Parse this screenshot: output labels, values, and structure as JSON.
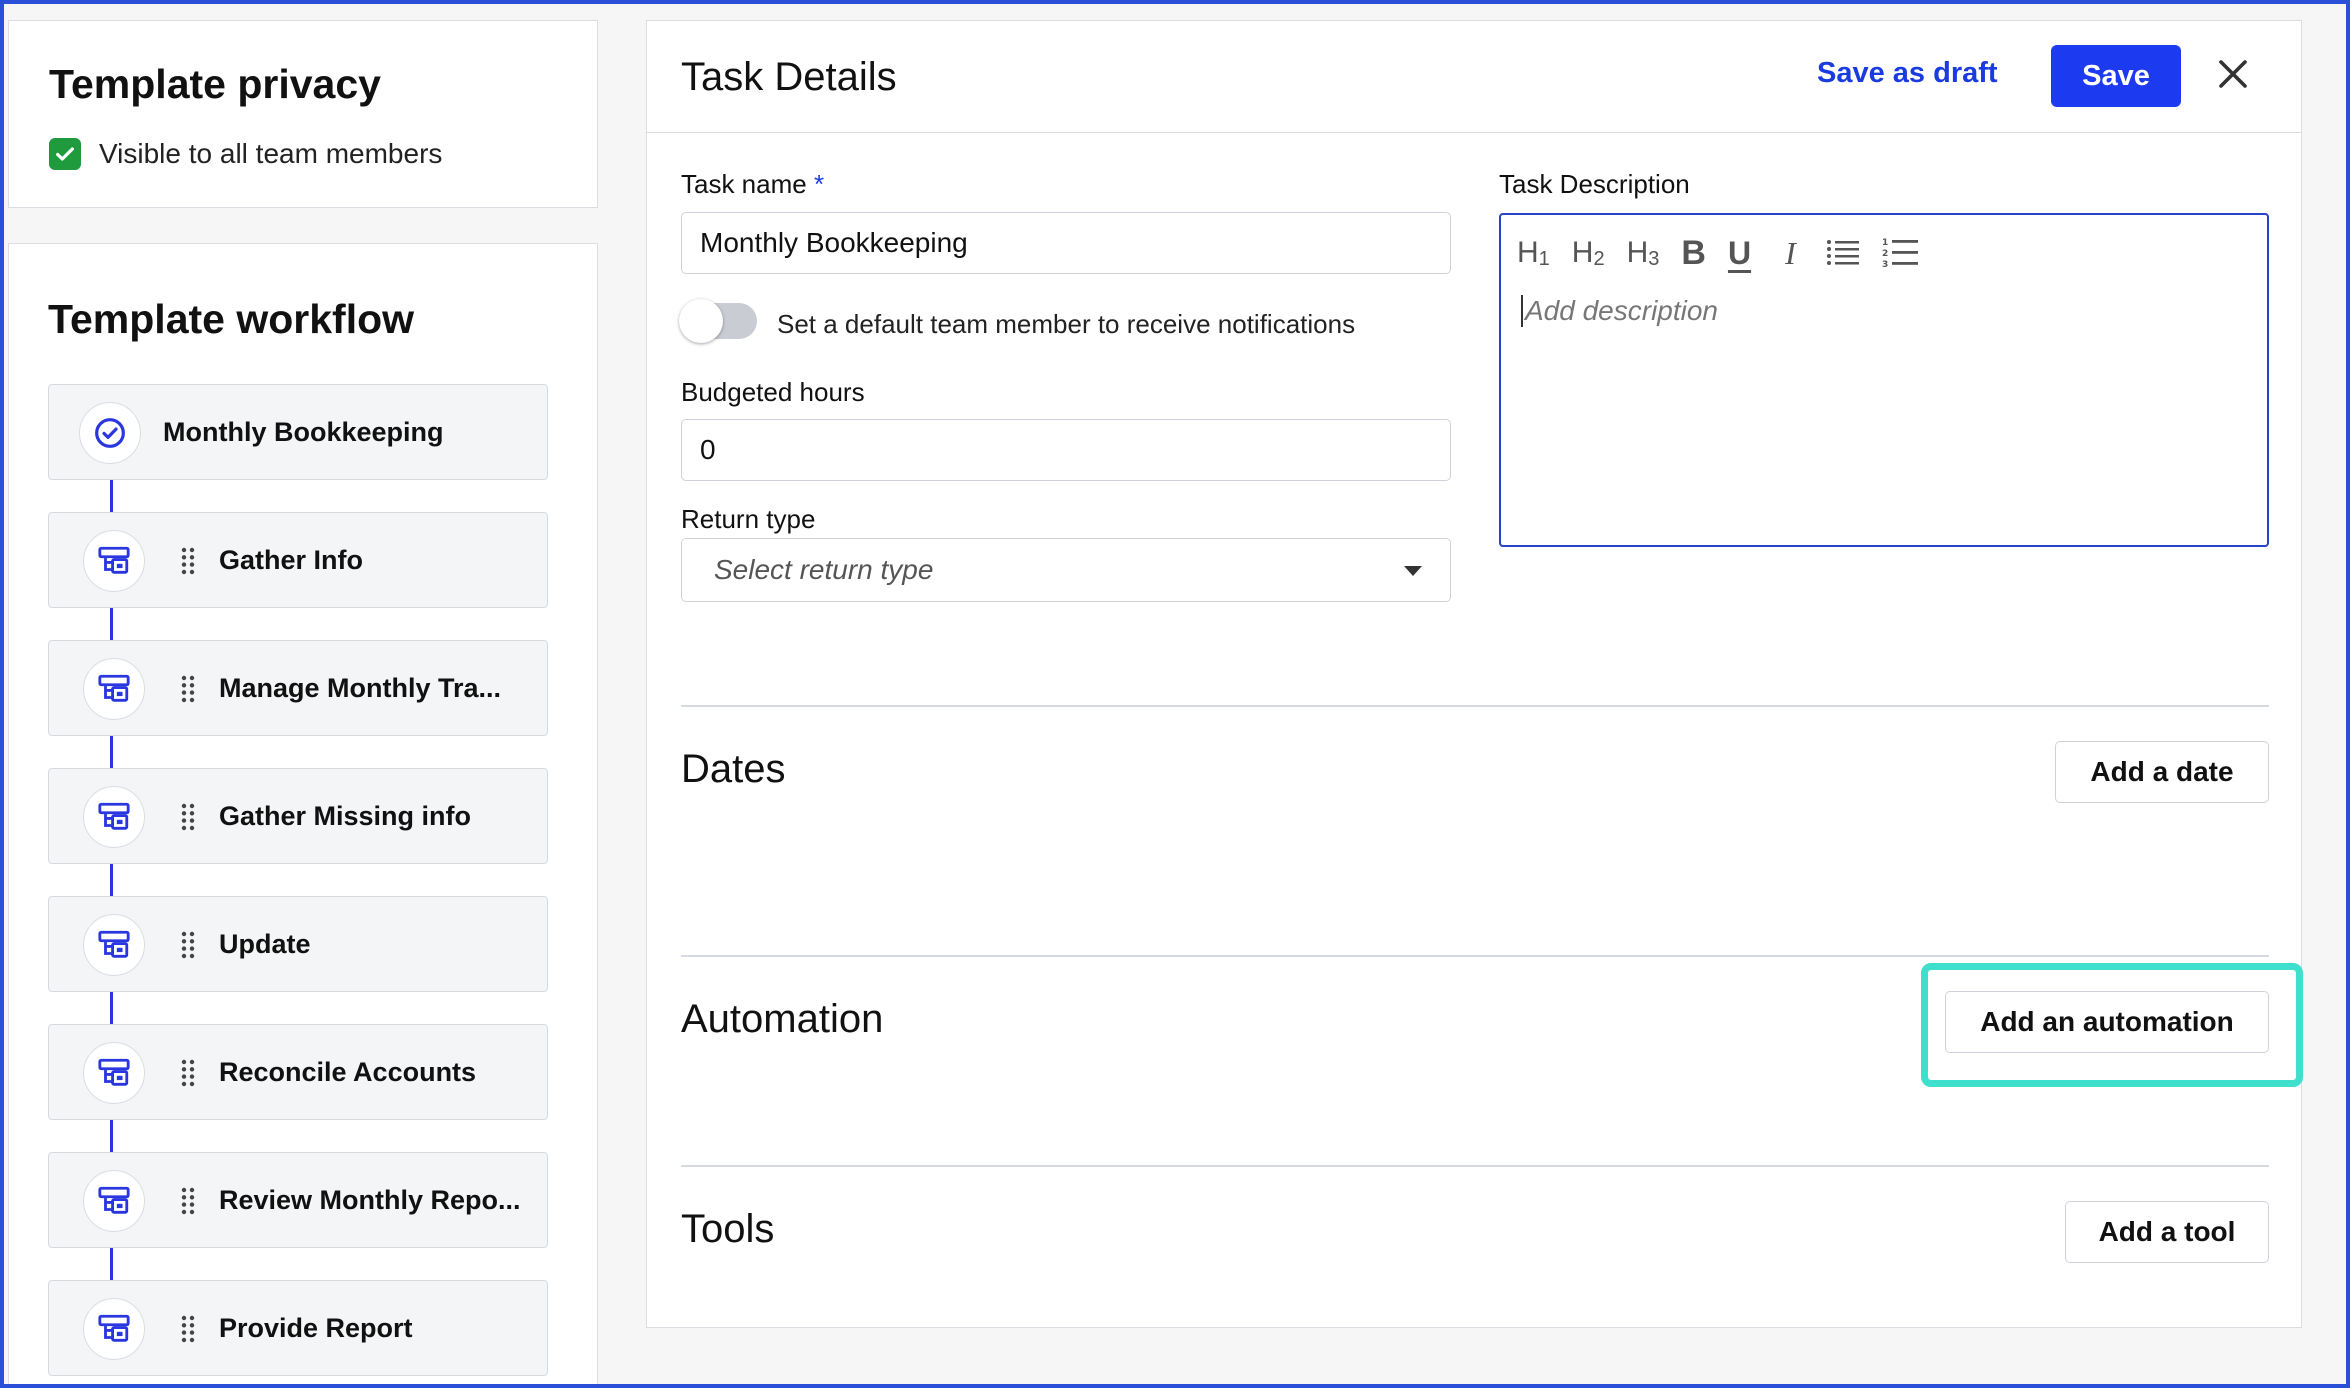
{
  "privacy": {
    "title": "Template privacy",
    "visible_label": "Visible to all team members",
    "visible_checked": true
  },
  "workflow": {
    "title": "Template workflow",
    "items": [
      {
        "label": "Monthly Bookkeeping",
        "icon": "check-circle-icon"
      },
      {
        "label": "Gather Info",
        "icon": "task-icon"
      },
      {
        "label": "Manage Monthly Tra...",
        "icon": "task-icon"
      },
      {
        "label": "Gather Missing info",
        "icon": "task-icon"
      },
      {
        "label": "Update",
        "icon": "task-icon"
      },
      {
        "label": "Reconcile Accounts",
        "icon": "task-icon"
      },
      {
        "label": "Review Monthly Repo...",
        "icon": "task-icon"
      },
      {
        "label": "Provide Report",
        "icon": "task-icon"
      }
    ]
  },
  "task": {
    "title": "Task Details",
    "save_draft_label": "Save as draft",
    "save_label": "Save",
    "name_label": "Task name",
    "required_mark": "*",
    "name_value": "Monthly Bookkeeping",
    "notify_toggle_label": "Set a default team member to receive notifications",
    "budgeted_label": "Budgeted hours",
    "budgeted_value": "0",
    "return_type_label": "Return type",
    "return_type_placeholder": "Select return type",
    "description_label": "Task Description",
    "description_placeholder": "Add description",
    "toolbar": {
      "h1": "H",
      "h1_sub": "1",
      "h2": "H",
      "h2_sub": "2",
      "h3": "H",
      "h3_sub": "3",
      "bold": "B",
      "underline": "U",
      "italic": "I"
    }
  },
  "sections": {
    "dates_title": "Dates",
    "dates_button": "Add a date",
    "automation_title": "Automation",
    "automation_button": "Add an automation",
    "tools_title": "Tools",
    "tools_button": "Add a tool"
  },
  "colors": {
    "accent": "#1c3af0",
    "check_green": "#1f9a3c",
    "highlight": "#3ee0cd",
    "frame": "#2b4fd6"
  }
}
